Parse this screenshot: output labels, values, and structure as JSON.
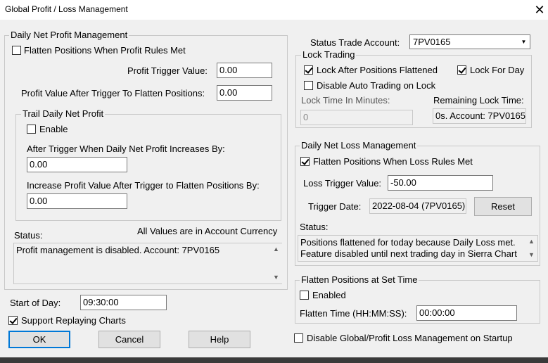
{
  "window": {
    "title": "Global Profit / Loss Management",
    "close_glyph": "✕"
  },
  "profit": {
    "legend": "Daily Net Profit Management",
    "flatten_label": "Flatten Positions When Profit Rules Met",
    "flatten_checked": false,
    "trigger_label": "Profit Trigger Value:",
    "trigger_value": "0.00",
    "after_trigger_label": "Profit Value After Trigger To Flatten Positions:",
    "after_trigger_value": "0.00",
    "trail": {
      "legend": "Trail Daily Net Profit",
      "enable_label": "Enable",
      "enable_checked": false,
      "increases_label": "After Trigger When Daily Net Profit Increases By:",
      "increases_value": "0.00",
      "increase_value_label": "Increase Profit Value After Trigger to Flatten Positions By:",
      "increase_value_value": "0.00"
    },
    "status_label": "Status:",
    "currency_note": "All Values are in Account Currency",
    "status_text": "Profit management is disabled. Account: 7PV0165"
  },
  "start_of_day": {
    "label": "Start of Day:",
    "value": "09:30:00"
  },
  "support_replay": {
    "label": "Support Replaying Charts",
    "checked": true
  },
  "buttons": {
    "ok": "OK",
    "cancel": "Cancel",
    "help": "Help",
    "reset": "Reset"
  },
  "account": {
    "label": "Status Trade Account:",
    "selected": "7PV0165"
  },
  "lock": {
    "legend": "Lock Trading",
    "after_flattened_label": "Lock After Positions Flattened",
    "after_flattened_checked": true,
    "for_day_label": "Lock For Day",
    "for_day_checked": true,
    "disable_auto_label": "Disable Auto Trading on Lock",
    "disable_auto_checked": false,
    "time_label": "Lock Time In Minutes:",
    "time_value": "0",
    "remaining_label": "Remaining Lock Time:",
    "remaining_value": "0s. Account: 7PV0165"
  },
  "loss": {
    "legend": "Daily Net Loss Management",
    "flatten_label": "Flatten Positions When Loss Rules Met",
    "flatten_checked": true,
    "trigger_label": "Loss Trigger Value:",
    "trigger_value": "-50.00",
    "date_label": "Trigger Date:",
    "date_value": "2022-08-04 (7PV0165)",
    "status_label": "Status:",
    "status_line1": "Positions flattened for today because Daily Loss met.",
    "status_line2": "Feature disabled until next trading day in Sierra Chart"
  },
  "set_time": {
    "legend": "Flatten Positions at Set Time",
    "enabled_label": "Enabled",
    "enabled_checked": false,
    "time_label": "Flatten Time (HH:MM:SS):",
    "time_value": "00:00:00"
  },
  "startup": {
    "label": "Disable Global/Profit Loss Management on Startup",
    "checked": false
  },
  "icons": {
    "up_arrow": "▲",
    "down_arrow": "▼"
  }
}
